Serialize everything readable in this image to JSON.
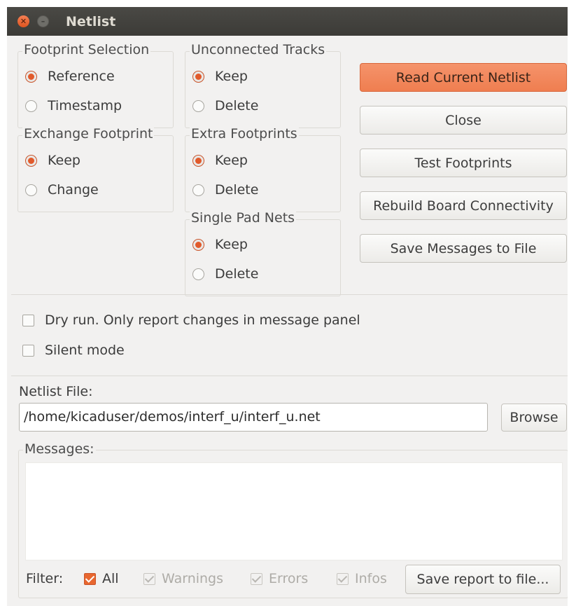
{
  "window": {
    "title": "Netlist"
  },
  "footprint_selection": {
    "label": "Footprint Selection",
    "options": [
      "Reference",
      "Timestamp"
    ],
    "selected": "Reference"
  },
  "unconnected_tracks": {
    "label": "Unconnected Tracks",
    "options": [
      "Keep",
      "Delete"
    ],
    "selected": "Keep"
  },
  "exchange_footprint": {
    "label": "Exchange Footprint",
    "options": [
      "Keep",
      "Change"
    ],
    "selected": "Keep"
  },
  "extra_footprints": {
    "label": "Extra Footprints",
    "options": [
      "Keep",
      "Delete"
    ],
    "selected": "Keep"
  },
  "single_pad_nets": {
    "label": "Single Pad Nets",
    "options": [
      "Keep",
      "Delete"
    ],
    "selected": "Keep"
  },
  "buttons": {
    "read_netlist": "Read Current Netlist",
    "close": "Close",
    "test_footprints": "Test Footprints",
    "rebuild_connectivity": "Rebuild Board Connectivity",
    "save_messages": "Save Messages to File"
  },
  "options": {
    "dry_run": {
      "label": "Dry run. Only report changes in message panel",
      "checked": false
    },
    "silent_mode": {
      "label": "Silent mode",
      "checked": false
    }
  },
  "netlist_file": {
    "label": "Netlist File:",
    "value": "/home/kicaduser/demos/interf_u/interf_u.net",
    "browse_label": "Browse"
  },
  "messages": {
    "label": "Messages:",
    "filter_label": "Filter:",
    "filters": [
      {
        "label": "All",
        "checked": true,
        "enabled": true
      },
      {
        "label": "Warnings",
        "checked": true,
        "enabled": false
      },
      {
        "label": "Errors",
        "checked": true,
        "enabled": false
      },
      {
        "label": "Infos",
        "checked": true,
        "enabled": false
      }
    ],
    "save_report_label": "Save report to file..."
  },
  "colors": {
    "accent": "#ef7e50",
    "titlebar": "#3c3b37",
    "background": "#f2f1f0"
  }
}
